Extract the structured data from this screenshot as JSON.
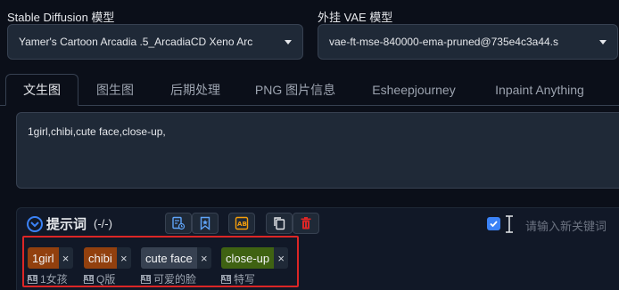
{
  "sd_model": {
    "label": "Stable Diffusion 模型",
    "value": "Yamer's Cartoon Arcadia .5_ArcadiaCD Xeno Arc"
  },
  "vae_model": {
    "label": "外挂 VAE 模型",
    "value": "vae-ft-mse-840000-ema-pruned@735e4c3a44.s"
  },
  "tabs": [
    {
      "label": "文生图"
    },
    {
      "label": "图生图"
    },
    {
      "label": "后期处理"
    },
    {
      "label": "PNG 图片信息"
    },
    {
      "label": "Esheepjourney"
    },
    {
      "label": "Inpaint Anything"
    }
  ],
  "prompt": {
    "text": "1girl,chibi,cute face,close-up,"
  },
  "prompt_toolbar": {
    "title": "提示词",
    "count": "(-/-)",
    "search_placeholder": "请输入新关键词"
  },
  "tags": [
    {
      "text": "1girl",
      "translation": "1女孩",
      "color": "#92400e"
    },
    {
      "text": "chibi",
      "translation": "Q版",
      "color": "#92400e"
    },
    {
      "text": "cute face",
      "translation": "可爱的脸",
      "color": "#374151"
    },
    {
      "text": "close-up",
      "translation": "特写",
      "color": "#3f6212"
    }
  ],
  "icons": {
    "translate_badge": "AB",
    "close_symbol": "×"
  }
}
